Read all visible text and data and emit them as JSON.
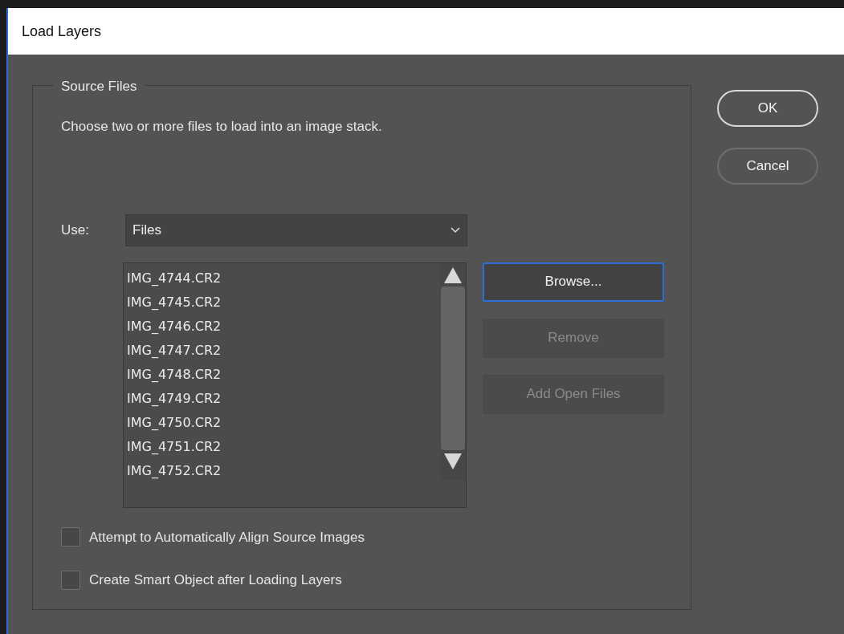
{
  "window": {
    "title": "Load Layers"
  },
  "group": {
    "title": "Source Files",
    "description": "Choose two or more files to load into an image stack."
  },
  "use": {
    "label": "Use:",
    "value": "Files"
  },
  "files": [
    {
      "name": "IMG_4744.CR2"
    },
    {
      "name": "IMG_4745.CR2"
    },
    {
      "name": "IMG_4746.CR2"
    },
    {
      "name": "IMG_4747.CR2"
    },
    {
      "name": "IMG_4748.CR2"
    },
    {
      "name": "IMG_4749.CR2"
    },
    {
      "name": "IMG_4750.CR2"
    },
    {
      "name": "IMG_4751.CR2"
    },
    {
      "name": "IMG_4752.CR2"
    }
  ],
  "file_buttons": [
    {
      "label": "Browse...",
      "disabled": false,
      "focused": true
    },
    {
      "label": "Remove",
      "disabled": true,
      "focused": false
    },
    {
      "label": "Add Open Files",
      "disabled": true,
      "focused": false
    }
  ],
  "options": [
    {
      "label": "Attempt to Automatically Align Source Images",
      "checked": false
    },
    {
      "label": "Create Smart Object after Loading Layers",
      "checked": false
    }
  ],
  "dialog_buttons": [
    {
      "label": "OK",
      "default": true
    },
    {
      "label": "Cancel",
      "default": false
    }
  ]
}
